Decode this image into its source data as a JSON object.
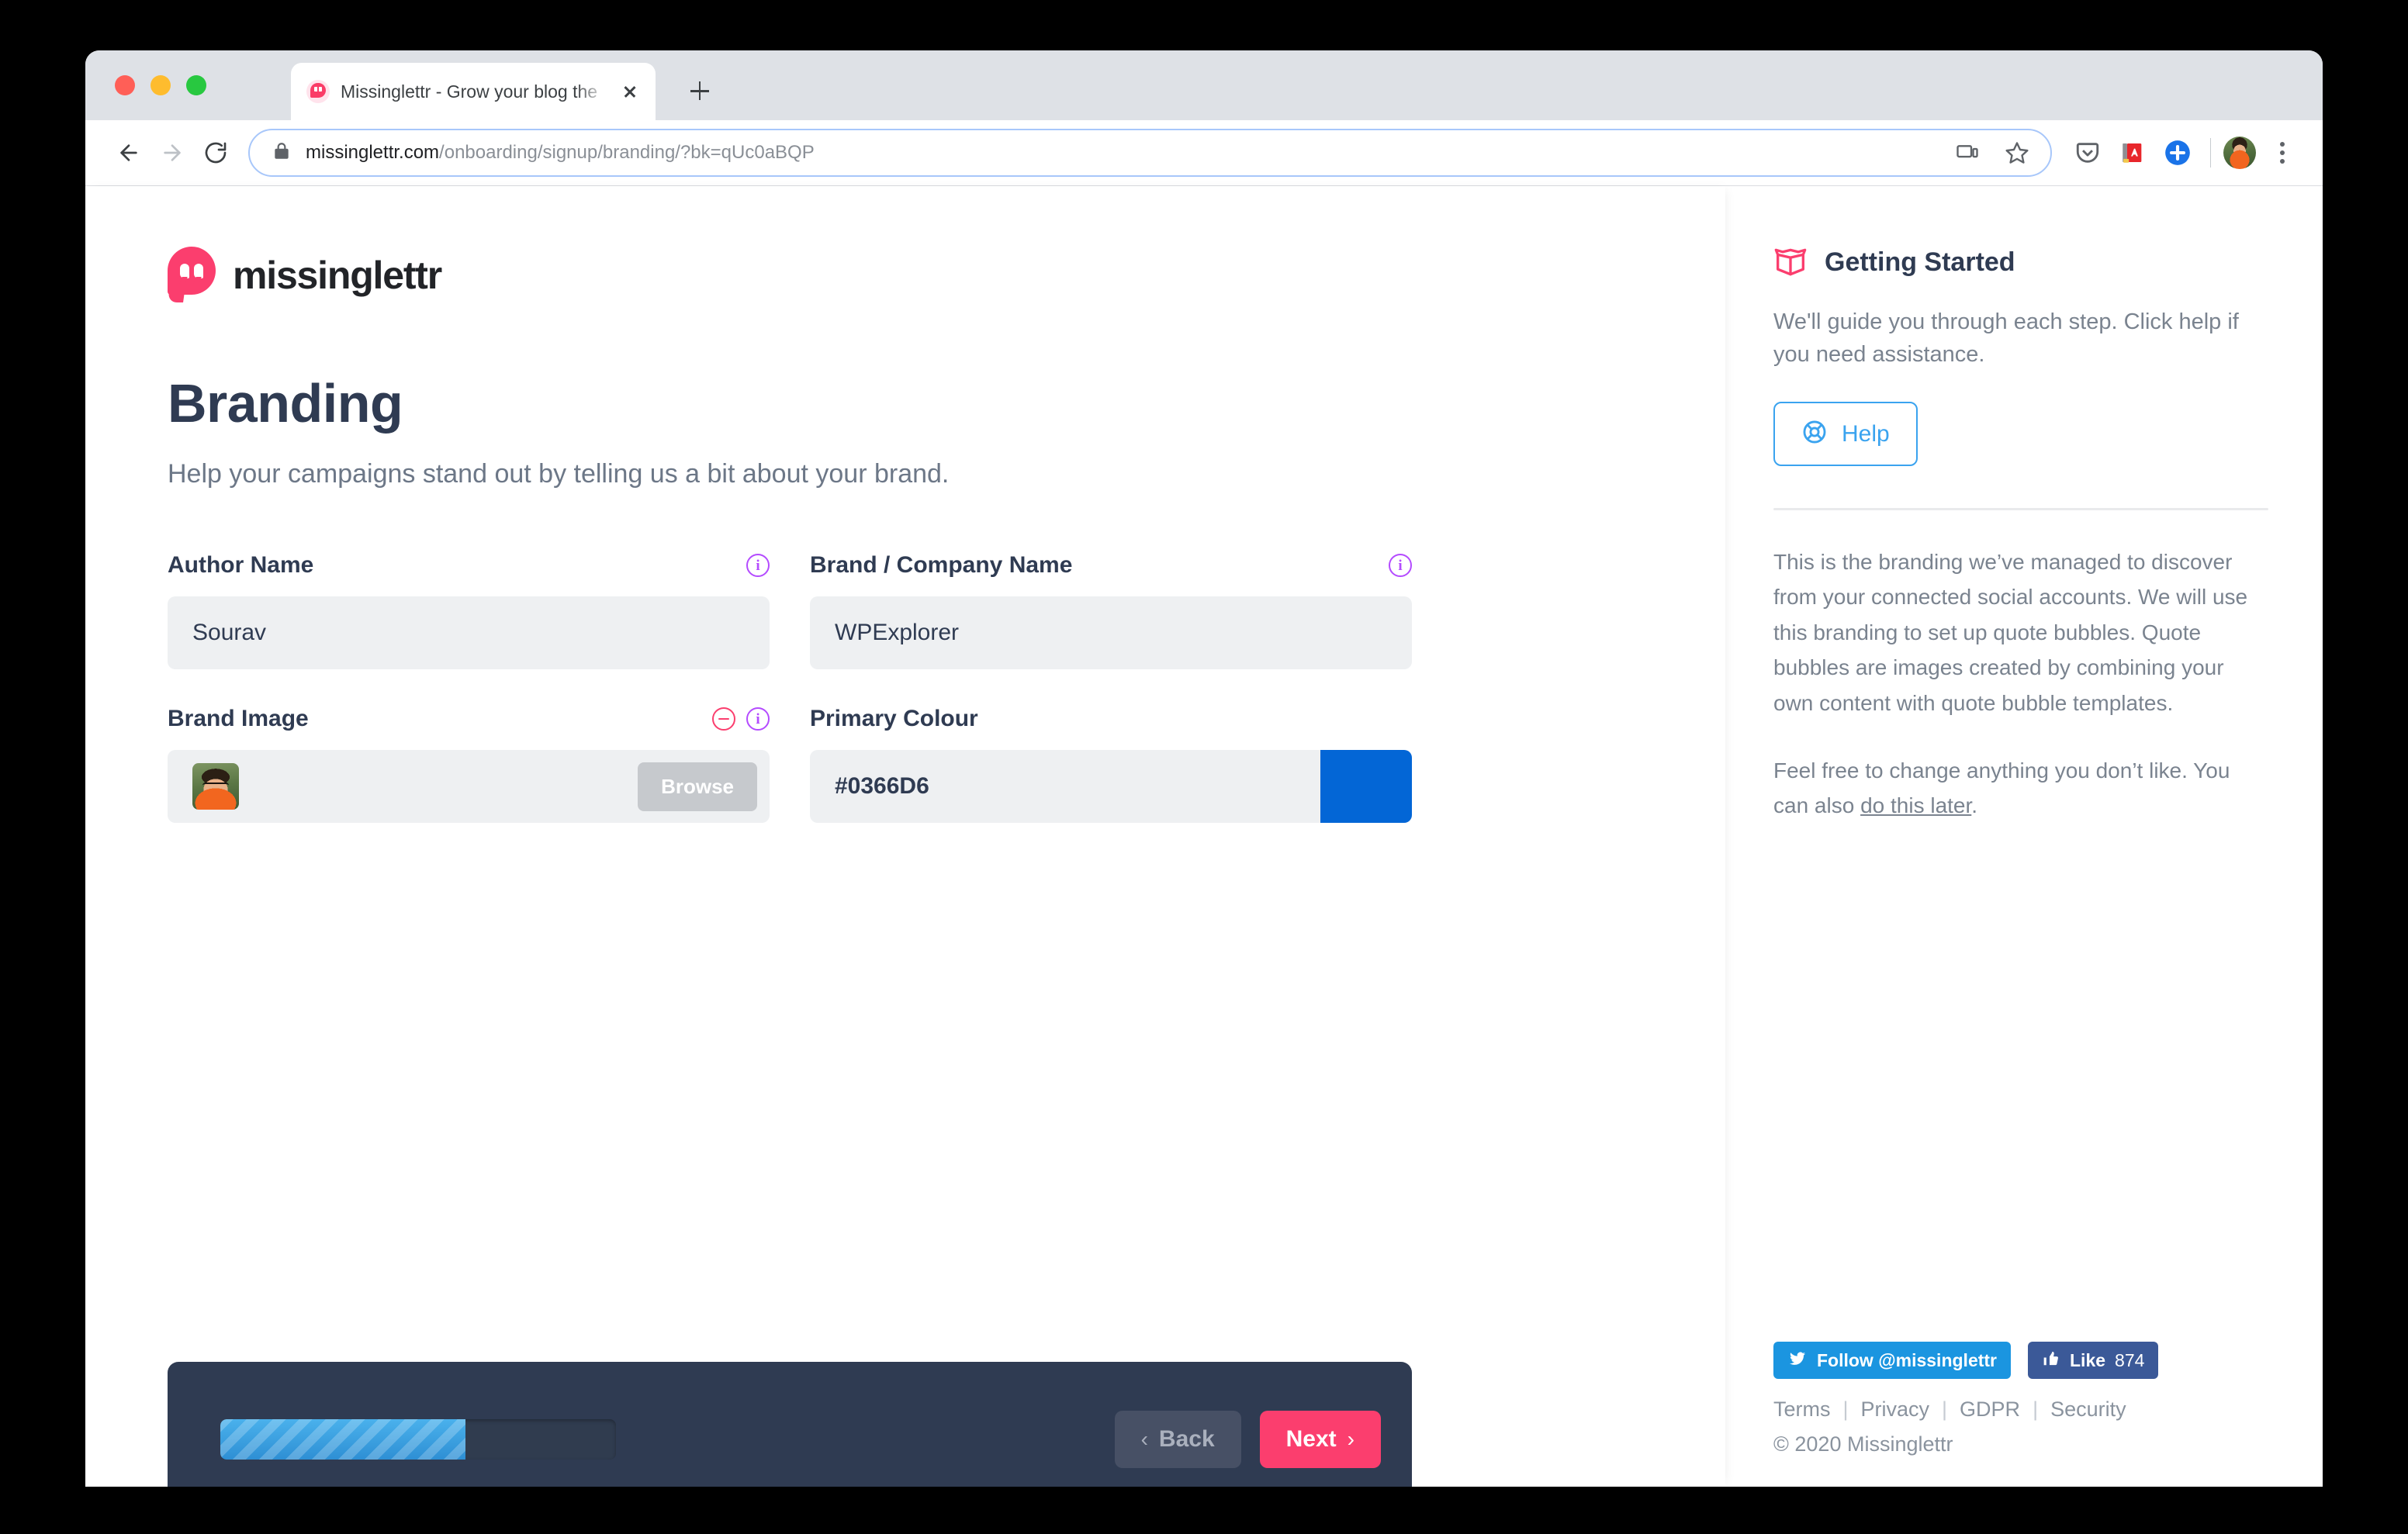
{
  "browser": {
    "tab_title": "Missinglettr - Grow your blog the",
    "url_host": "missinglettr.com",
    "url_path": "/onboarding/signup/branding/?bk=qUc0aBQP",
    "icons": {
      "back": "back-arrow-icon",
      "forward": "forward-arrow-icon",
      "reload": "reload-icon",
      "lock": "lock-icon",
      "cast": "cast-icon",
      "bookmark": "star-icon",
      "pocket": "pocket-icon",
      "dictionary": "red-book-extension-icon",
      "add": "blue-plus-circle-icon",
      "profile": "avatar-icon",
      "menu": "three-dot-menu-icon",
      "new_tab": "plus-icon",
      "close_tab": "close-icon"
    }
  },
  "brand": {
    "logo_word": "missinglettr",
    "accent_pink": "#fb3e6e",
    "dark_navy": "#2f3b52"
  },
  "main": {
    "title": "Branding",
    "subtitle": "Help your campaigns stand out by telling us a bit about your brand.",
    "fields": [
      {
        "label": "Author Name",
        "value": "Sourav",
        "placeholder": "Author Name",
        "icons": [
          "info-icon"
        ]
      },
      {
        "label": "Brand / Company Name",
        "value": "WPExplorer",
        "placeholder": "Brand / Company Name",
        "icons": [
          "info-icon"
        ]
      },
      {
        "label": "Brand Image",
        "browse_label": "Browse",
        "icons": [
          "remove-icon",
          "info-icon"
        ]
      },
      {
        "label": "Primary Colour",
        "value": "#0366D6",
        "swatch_colour": "#0366D6",
        "icons": []
      }
    ]
  },
  "wizard": {
    "progress_percent": 62,
    "back_label": "Back",
    "next_label": "Next",
    "back_chevron": "‹",
    "next_chevron": "›"
  },
  "sidebar": {
    "title": "Getting Started",
    "intro": "We'll guide you through each step. Click help if you need assistance.",
    "help_label": "Help",
    "paragraphs": [
      "This is the branding we’ve managed to discover from your connected social accounts. We will use this branding to set up quote bubbles. Quote bubbles are images created by combining your own content with quote bubble templates.",
      "Feel free to change anything you don’t like. You can also "
    ],
    "do_this_later": "do this later",
    "paragraph_tail": ".",
    "footer": {
      "twitter_label": "Follow @missinglettr",
      "facebook_label": "Like",
      "facebook_count": "874",
      "links": [
        "Terms",
        "Privacy",
        "GDPR",
        "Security"
      ],
      "copyright": "© 2020 Missinglettr"
    }
  }
}
